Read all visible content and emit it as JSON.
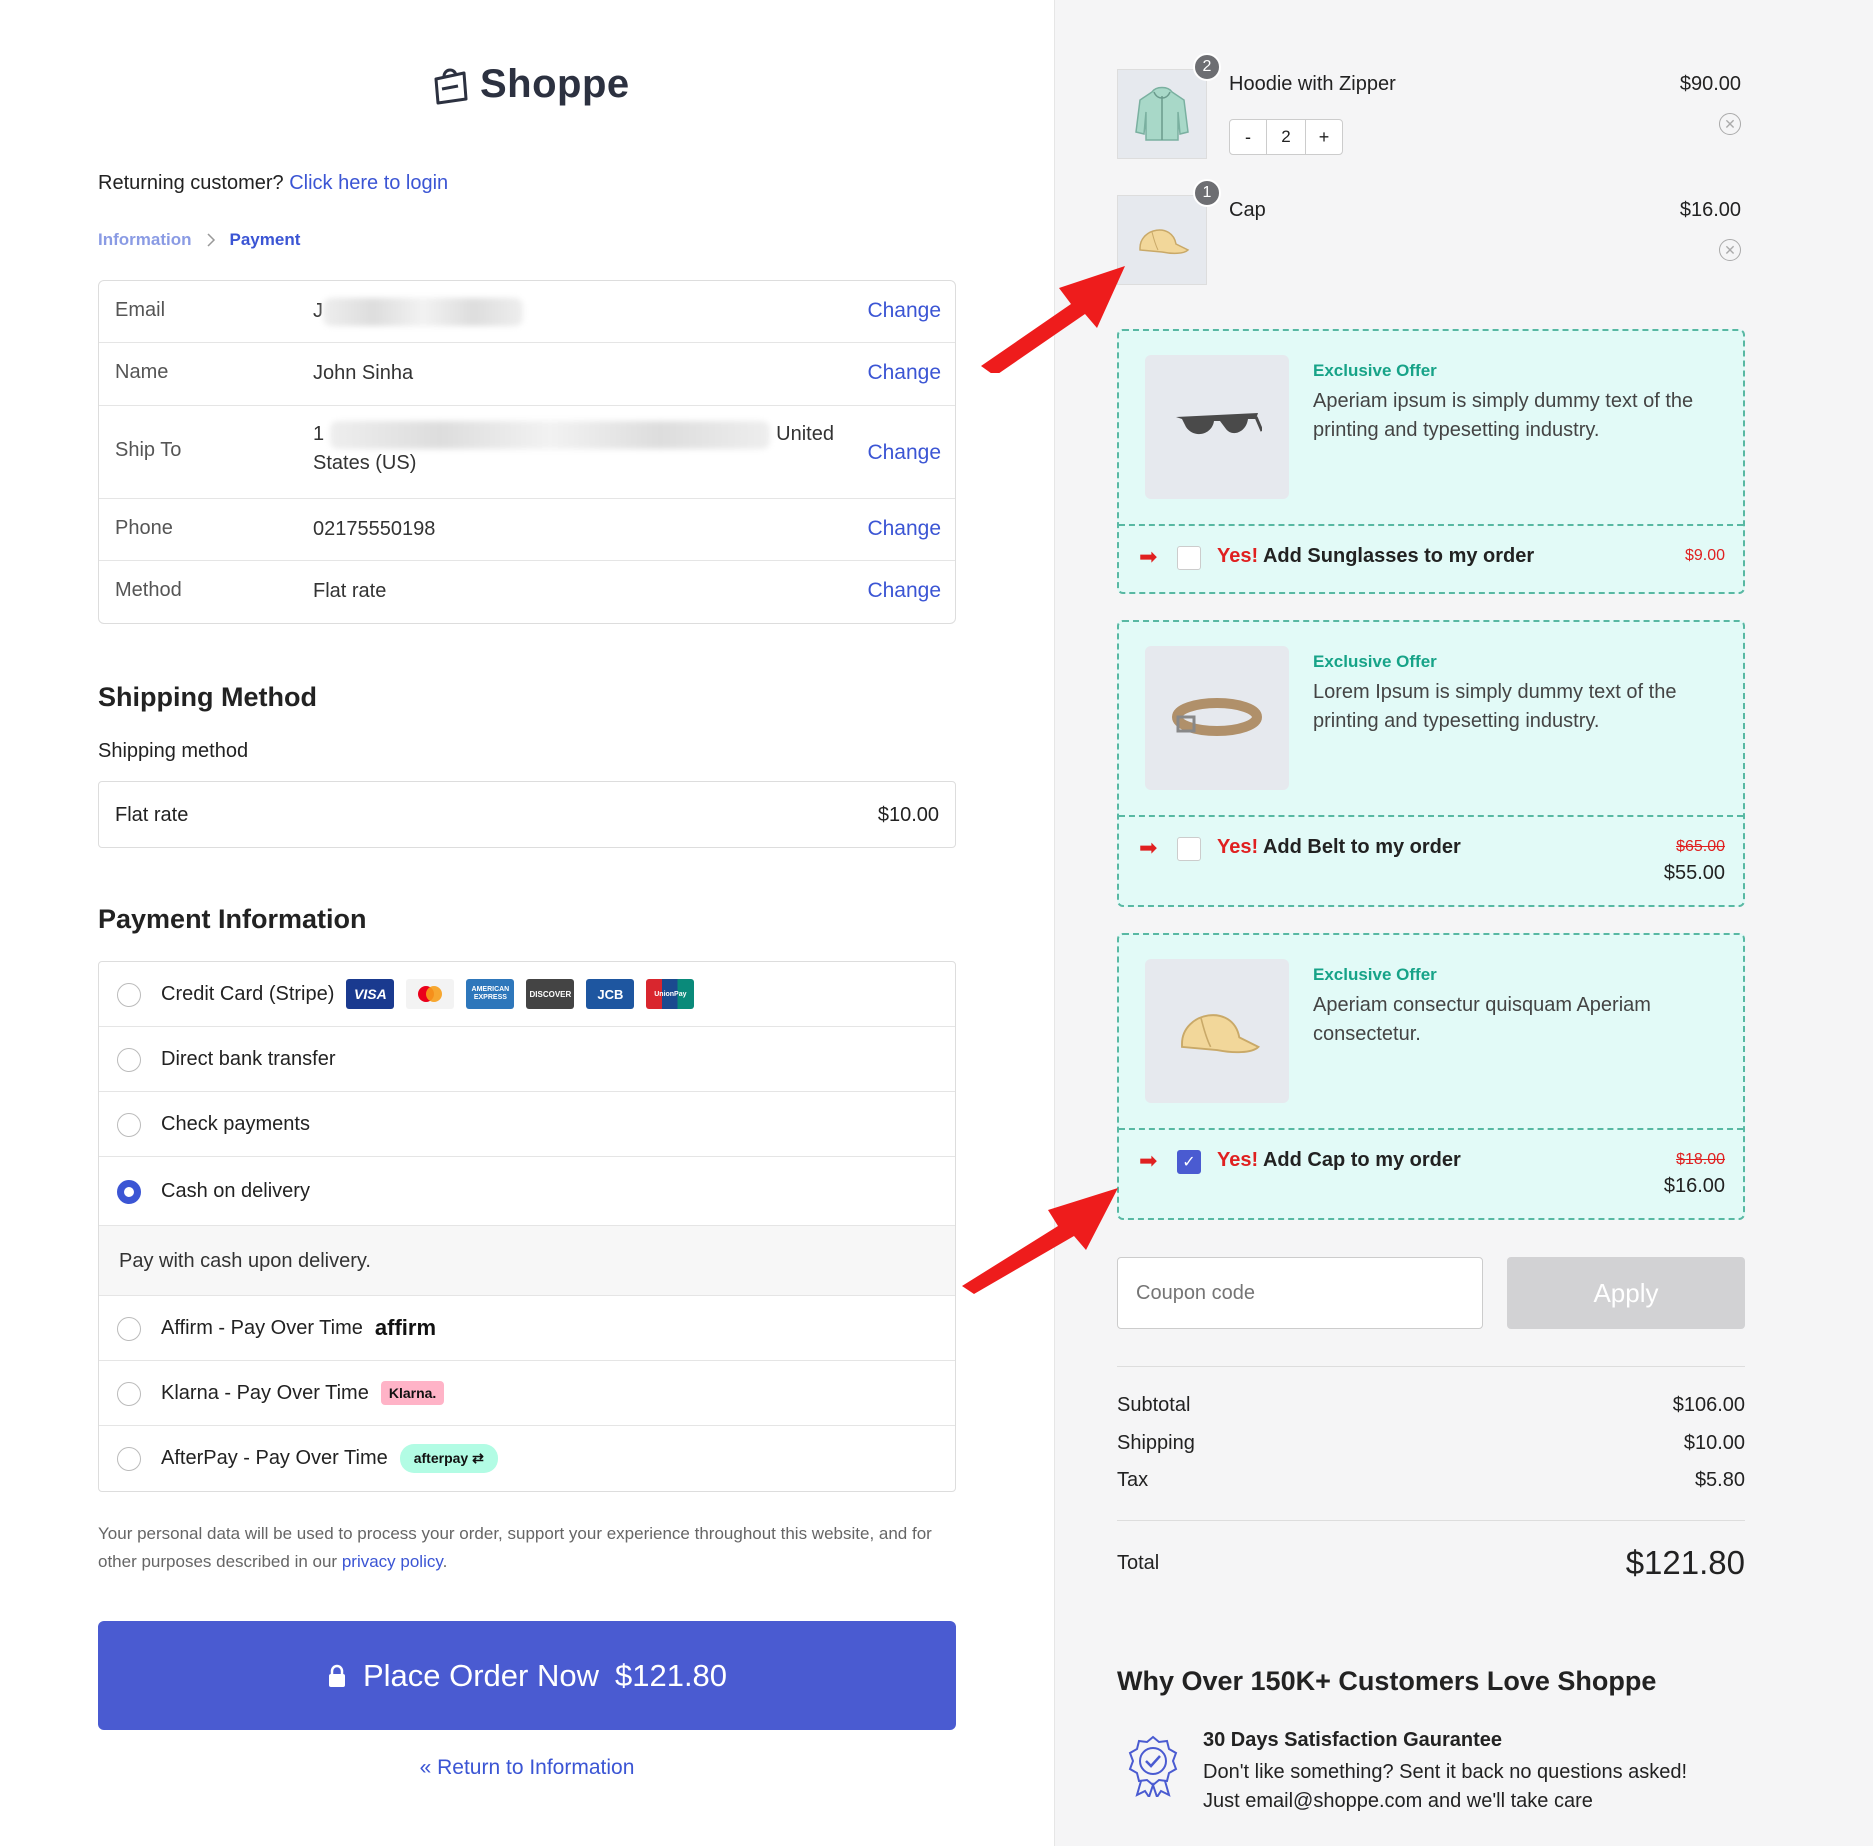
{
  "brand": {
    "name": "Shoppe"
  },
  "returning": {
    "prefix": "Returning customer?",
    "link": "Click here to login"
  },
  "breadcrumb": {
    "step1": "Information",
    "separator": ">",
    "step2": "Payment"
  },
  "info": {
    "change_label": "Change",
    "rows": [
      {
        "label": "Email",
        "value": "J"
      },
      {
        "label": "Name",
        "value": "John Sinha"
      },
      {
        "label": "Ship To",
        "value_start": "1",
        "value_end": "United",
        "value_line2": "States (US)"
      },
      {
        "label": "Phone",
        "value": "02175550198"
      },
      {
        "label": "Method",
        "value": "Flat rate"
      }
    ]
  },
  "shipping": {
    "heading": "Shipping Method",
    "label": "Shipping method",
    "option": "Flat rate",
    "price": "$10.00"
  },
  "payment": {
    "heading": "Payment Information",
    "options": [
      {
        "label": "Credit Card (Stripe)",
        "selected": false
      },
      {
        "label": "Direct bank transfer",
        "selected": false
      },
      {
        "label": "Check payments",
        "selected": false
      },
      {
        "label": "Cash on delivery",
        "selected": true
      },
      {
        "label": "Affirm - Pay Over Time",
        "selected": false,
        "badge": "affirm"
      },
      {
        "label": "Klarna - Pay Over Time",
        "selected": false,
        "badge": "Klarna."
      },
      {
        "label": "AfterPay - Pay Over Time",
        "selected": false,
        "badge": "afterpay"
      }
    ],
    "cards": [
      "VISA",
      "mastercard",
      "AMERICAN EXPRESS",
      "DISCOVER",
      "JCB",
      "UnionPay"
    ],
    "cod_description": "Pay with cash upon delivery."
  },
  "privacy": {
    "text": "Your personal data will be used to process your order, support your experience throughout this website, and for other purposes described in our",
    "link": "privacy policy",
    "end": "."
  },
  "place_order": {
    "label": "Place Order Now",
    "amount": "$121.80"
  },
  "return_link": "« Return to Information",
  "cart": {
    "items": [
      {
        "name": "Hoodie with Zipper",
        "price": "$90.00",
        "qty": "2"
      },
      {
        "name": "Cap",
        "price": "$16.00",
        "qty": "1"
      }
    ],
    "stepper": {
      "minus": "-",
      "plus": "+"
    }
  },
  "offers": [
    {
      "tag": "Exclusive Offer",
      "text": "Aperiam ipsum is simply dummy text of the printing and typesetting industry.",
      "yes": "Yes!",
      "action": "Add Sunglasses to my order",
      "old_price": "",
      "price": "$9.00",
      "checked": false
    },
    {
      "tag": "Exclusive Offer",
      "text": "Lorem Ipsum is simply dummy text of the printing and typesetting industry.",
      "yes": "Yes!",
      "action": "Add Belt to my order",
      "old_price": "$65.00",
      "price": "$55.00",
      "checked": true
    },
    {
      "tag": "Exclusive Offer",
      "text": "Aperiam consectur quisquam Aperiam consectetur.",
      "yes": "Yes!",
      "action": "Add Cap to my order",
      "old_price": "$18.00",
      "price": "$16.00",
      "checked": true
    }
  ],
  "coupon": {
    "placeholder": "Coupon code",
    "apply": "Apply"
  },
  "totals": {
    "subtotal_label": "Subtotal",
    "subtotal": "$106.00",
    "shipping_label": "Shipping",
    "shipping": "$10.00",
    "tax_label": "Tax",
    "tax": "$5.80",
    "total_label": "Total",
    "total": "$121.80"
  },
  "why": {
    "heading": "Why Over 150K+ Customers Love Shoppe",
    "guarantee_title": "30 Days Satisfaction Gaurantee",
    "guarantee_line1": "Don't like something? Sent it back no questions asked!",
    "guarantee_line2": "Just email@shoppe.com and we'll take care"
  },
  "colors": {
    "accent": "#4a5bd1",
    "offer_bg": "#e2faf7",
    "offer_border": "#58b8a3",
    "red": "#e02020"
  }
}
